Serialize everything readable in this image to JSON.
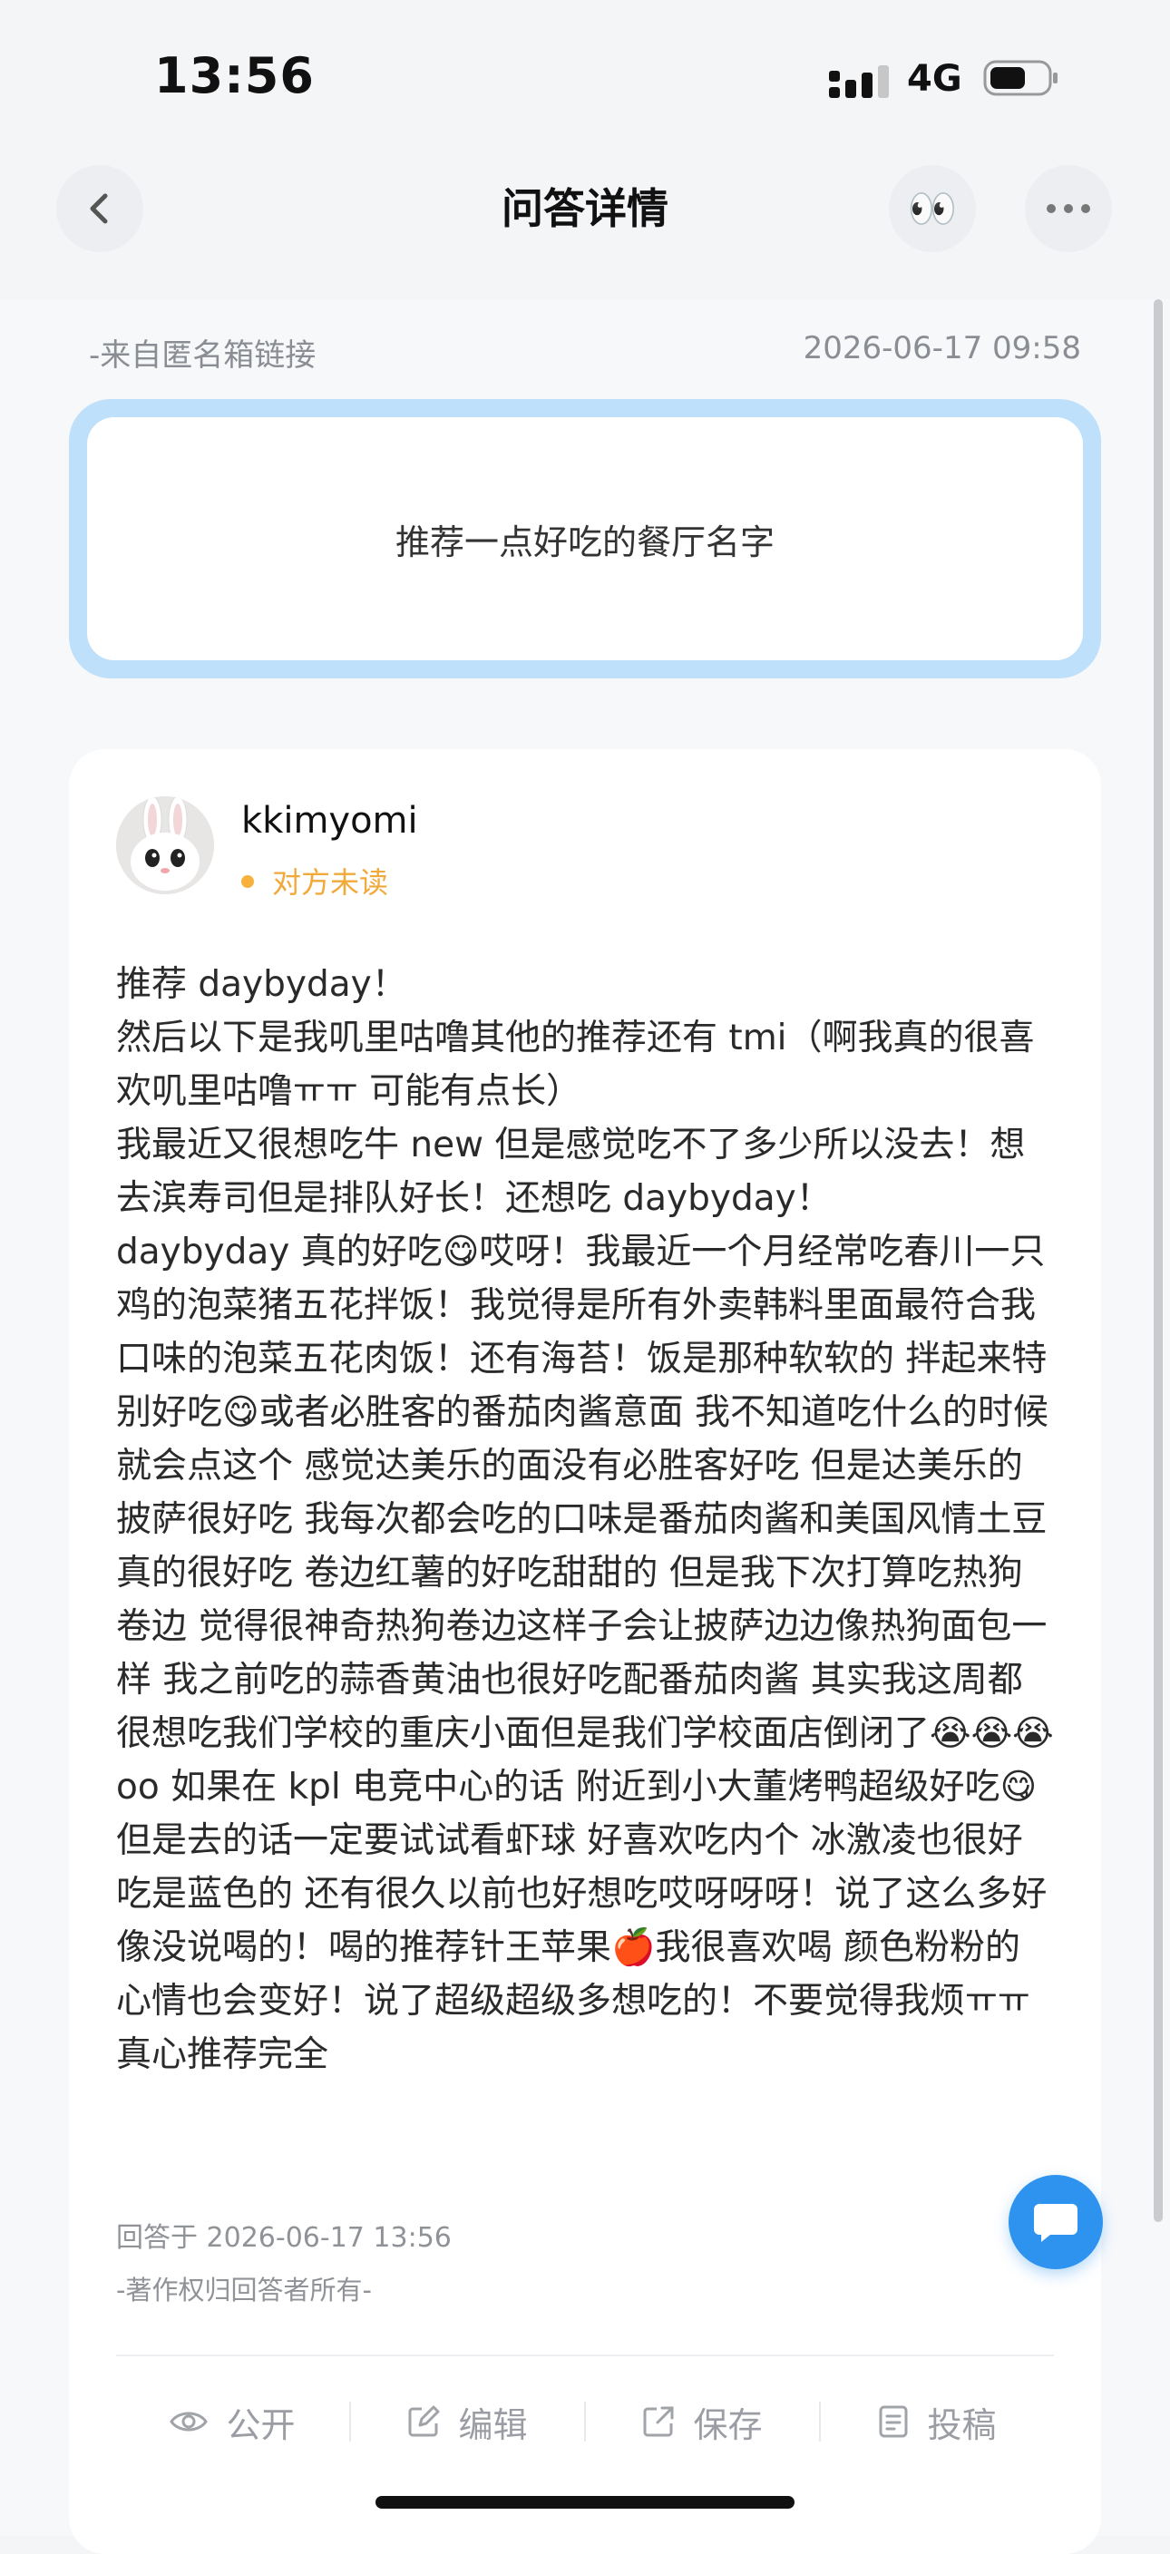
{
  "status_bar": {
    "time": "13:56",
    "network": "4G"
  },
  "nav": {
    "title": "问答详情",
    "eyes_emoji": "👀"
  },
  "question": {
    "source": "-来自匿名箱链接",
    "time": "2026-06-17 09:58",
    "text": "推荐一点好吃的餐厅名字"
  },
  "answer": {
    "username": "kkimyomi",
    "read_status": "对方未读",
    "body": "推荐 daybyday！\n然后以下是我叽里咕噜其他的推荐还有 tmi（啊我真的很喜欢叽里咕噜ㅠㅠ 可能有点长）\n我最近又很想吃牛 new 但是感觉吃不了多少所以没去！想去滨寿司但是排队好长！还想吃 daybyday！\ndaybyday 真的好吃😋哎呀！我最近一个月经常吃春川一只鸡的泡菜猪五花拌饭！我觉得是所有外卖韩料里面最符合我口味的泡菜五花肉饭！还有海苔！饭是那种软软的 拌起来特别好吃😋或者必胜客的番茄肉酱意面 我不知道吃什么的时候就会点这个 感觉达美乐的面没有必胜客好吃 但是达美乐的披萨很好吃 我每次都会吃的口味是番茄肉酱和美国风情土豆 真的很好吃 卷边红薯的好吃甜甜的 但是我下次打算吃热狗卷边 觉得很神奇热狗卷边这样子会让披萨边边像热狗面包一样 我之前吃的蒜香黄油也很好吃配番茄肉酱 其实我这周都很想吃我们学校的重庆小面但是我们学校面店倒闭了😭😭😭oo 如果在 kpl 电竞中心的话 附近到小大董烤鸭超级好吃😋但是去的话一定要试试看虾球 好喜欢吃内个 冰激凌也很好吃是蓝色的 还有很久以前也好想吃哎呀呀呀！说了这么多好像没说喝的！喝的推荐针王苹果🍎我很喜欢喝 颜色粉粉的心情也会变好！说了超级超级多想吃的！不要觉得我烦ㅠㅠ真心推荐完全",
    "answered_at": "回答于 2026-06-17 13:56",
    "copyright": "-著作权归回答者所有-"
  },
  "toolbar": {
    "public_label": "公开",
    "edit_label": "编辑",
    "save_label": "保存",
    "submit_label": "投稿"
  },
  "icons": {
    "back": "chevron-left-icon",
    "more": "more-dots-icon",
    "eye": "eye-icon",
    "edit": "edit-icon",
    "save": "save-icon",
    "submit": "document-icon",
    "chat": "chat-bubble-icon"
  },
  "colors": {
    "accent_blue": "#2d93ee",
    "question_border": "#bfe0fb",
    "unread_orange": "#f1a93a"
  }
}
